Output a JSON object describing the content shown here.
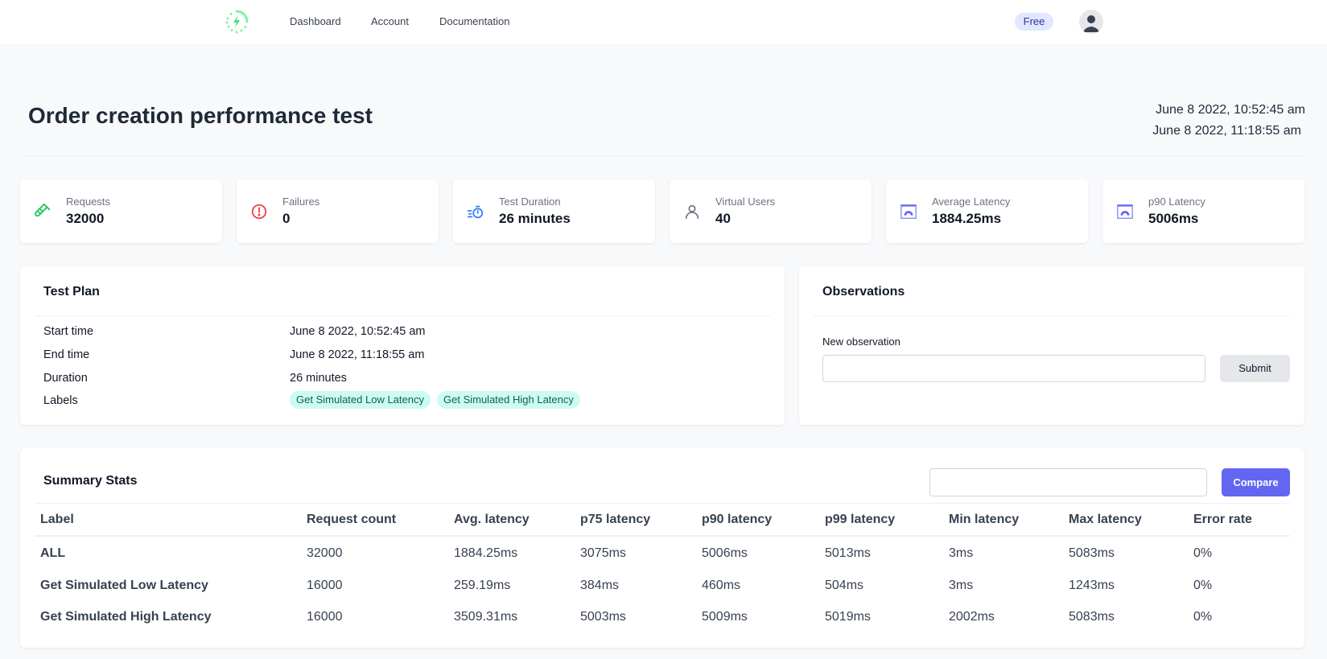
{
  "nav": {
    "logo_icon": "lightning-logo-icon",
    "links": [
      "Dashboard",
      "Account",
      "Documentation"
    ],
    "plan_badge": "Free",
    "avatar_icon": "user-avatar-icon"
  },
  "header": {
    "title": "Order creation performance test",
    "start_date": "June 8 2022, 10:52:45 am",
    "end_date": "June 8 2022, 11:18:55 am"
  },
  "stats": [
    {
      "label": "Requests",
      "value": "32000",
      "icon": "test-tube-icon",
      "color": "#22c55e"
    },
    {
      "label": "Failures",
      "value": "0",
      "icon": "exclamation-circle-icon",
      "color": "#ef4444"
    },
    {
      "label": "Test Duration",
      "value": "26 minutes",
      "icon": "stopwatch-icon",
      "color": "#3b82f6"
    },
    {
      "label": "Virtual Users",
      "value": "40",
      "icon": "user-icon",
      "color": "#6b7280"
    },
    {
      "label": "Average Latency",
      "value": "1884.25ms",
      "icon": "speedometer-icon",
      "color": "#6366f1"
    },
    {
      "label": "p90 Latency",
      "value": "5006ms",
      "icon": "speedometer-icon",
      "color": "#6366f1"
    }
  ],
  "test_plan": {
    "title": "Test Plan",
    "rows": [
      {
        "label": "Start time",
        "value": "June 8 2022, 10:52:45 am"
      },
      {
        "label": "End time",
        "value": "June 8 2022, 11:18:55 am"
      },
      {
        "label": "Duration",
        "value": "26 minutes"
      }
    ],
    "labels_title": "Labels",
    "labels": [
      "Get Simulated Low Latency",
      "Get Simulated High Latency"
    ]
  },
  "observations": {
    "title": "Observations",
    "field_label": "New observation",
    "input_value": "",
    "submit_label": "Submit"
  },
  "summary": {
    "title": "Summary Stats",
    "compare_input_value": "",
    "compare_label": "Compare",
    "columns": [
      "Label",
      "Request count",
      "Avg. latency",
      "p75 latency",
      "p90 latency",
      "p99 latency",
      "Min latency",
      "Max latency",
      "Error rate"
    ],
    "rows": [
      [
        "ALL",
        "32000",
        "1884.25ms",
        "3075ms",
        "5006ms",
        "5013ms",
        "3ms",
        "5083ms",
        "0%"
      ],
      [
        "Get Simulated Low Latency",
        "16000",
        "259.19ms",
        "384ms",
        "460ms",
        "504ms",
        "3ms",
        "1243ms",
        "0%"
      ],
      [
        "Get Simulated High Latency",
        "16000",
        "3509.31ms",
        "5003ms",
        "5009ms",
        "5019ms",
        "2002ms",
        "5083ms",
        "0%"
      ]
    ]
  },
  "colors": {
    "accent": "#6366f1",
    "logo": "#4ade80",
    "pill_bg": "#ccfbf1",
    "pill_text": "#115e59",
    "badge_bg": "#e0e7ff"
  }
}
